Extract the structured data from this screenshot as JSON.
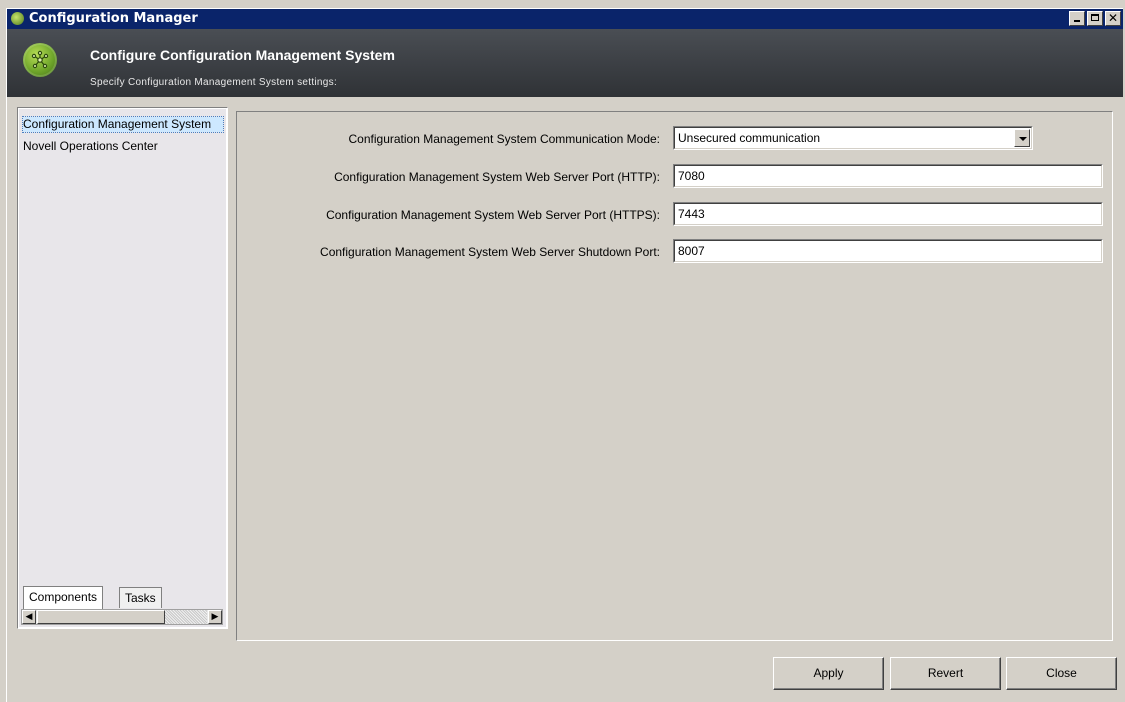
{
  "window": {
    "title": "Configuration Manager",
    "controls": {
      "minimize": "_",
      "maximize": "□",
      "close": "✕"
    }
  },
  "header": {
    "title": "Configure Configuration Management System",
    "subtitle": "Specify Configuration Management System settings:"
  },
  "sidebar": {
    "items": [
      {
        "label": "Configuration Management System",
        "selected": true
      },
      {
        "label": "Novell Operations Center",
        "selected": false
      }
    ],
    "tabs": [
      {
        "label": "Components",
        "active": true
      },
      {
        "label": "Tasks",
        "active": false
      }
    ],
    "scroll": {
      "left": "◀",
      "right": "▶"
    }
  },
  "form": {
    "comm_mode": {
      "label": "Configuration Management System Communication Mode:",
      "value": "Unsecured communication"
    },
    "http_port": {
      "label": "Configuration Management System Web Server Port (HTTP):",
      "value": "7080"
    },
    "https_port": {
      "label": "Configuration Management System Web Server Port (HTTPS):",
      "value": "7443"
    },
    "shutdown_port": {
      "label": "Configuration Management System Web Server Shutdown Port:",
      "value": "8007"
    }
  },
  "buttons": {
    "apply": "Apply",
    "revert": "Revert",
    "close": "Close"
  },
  "colors": {
    "titlebar": "#0a246a",
    "header": "#3a3d42",
    "accent_green": "#6ea52a",
    "selection": "#cde8ff"
  }
}
